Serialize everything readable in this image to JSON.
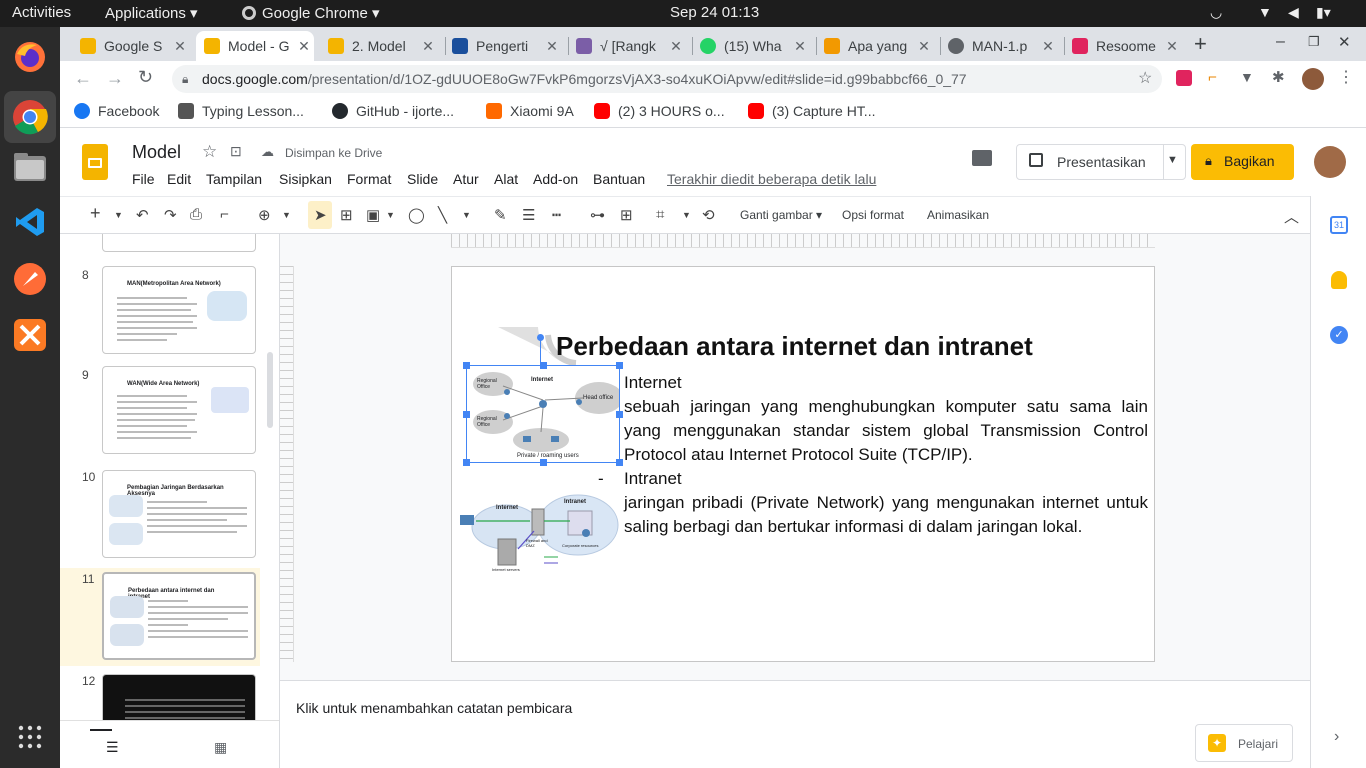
{
  "system": {
    "activities": "Activities",
    "applications": "Applications",
    "app_name": "Google Chrome",
    "datetime": "Sep 24  01:13"
  },
  "tabs": [
    {
      "title": "Google S",
      "color": "#f4b400"
    },
    {
      "title": "Model - G",
      "color": "#f4b400"
    },
    {
      "title": "2. Model",
      "color": "#f4b400"
    },
    {
      "title": "Pengerti",
      "color": "#1a4f9c"
    },
    {
      "title": "√ [Rangk",
      "color": "#7b5ea7"
    },
    {
      "title": "(15) Wha",
      "color": "#25d366"
    },
    {
      "title": "Apa yang",
      "color": "#f29900"
    },
    {
      "title": "MAN-1.p",
      "color": "#5f6368"
    },
    {
      "title": "Resoome",
      "color": "#e0245e"
    }
  ],
  "address": {
    "domain": "docs.google.com",
    "path": "/presentation/d/1OZ-gdUUOE8oGw7FvkP6mgorzsVjAX3-so4xuKOiApvw/edit#slide=id.g99babbcf66_0_77"
  },
  "bookmarks": [
    {
      "label": "Facebook",
      "color": "#1877f2"
    },
    {
      "label": "Typing Lesson...",
      "color": "#555555"
    },
    {
      "label": "GitHub - ijorte...",
      "color": "#24292e"
    },
    {
      "label": "Xiaomi 9A",
      "color": "#ff6900"
    },
    {
      "label": "(2) 3 HOURS o...",
      "color": "#ff0000"
    },
    {
      "label": "(3) Capture HT...",
      "color": "#ff0000"
    }
  ],
  "doc": {
    "title": "Model",
    "save_status": "Disimpan ke Drive",
    "last_edit": "Terakhir diedit beberapa detik lalu",
    "present_label": "Presentasikan",
    "share_label": "Bagikan"
  },
  "menus": [
    "File",
    "Edit",
    "Tampilan",
    "Sisipkan",
    "Format",
    "Slide",
    "Atur",
    "Alat",
    "Add-on",
    "Bantuan"
  ],
  "toolbar": {
    "replace_image": "Ganti gambar",
    "format_options": "Opsi format",
    "animate": "Animasikan"
  },
  "filmstrip": {
    "slides": [
      {
        "num": "8",
        "title": "MAN(Metropolitan Area Network)"
      },
      {
        "num": "9",
        "title": "WAN(Wide Area Network)"
      },
      {
        "num": "10",
        "title": "Pembagian Jaringan Berdasarkan Aksesnya"
      },
      {
        "num": "11",
        "title": "Perbedaan antara internet dan intranet"
      },
      {
        "num": "12",
        "title": ""
      }
    ]
  },
  "slide": {
    "title": "Perbedaan antara internet dan intranet",
    "bullet1_label": "Internet",
    "bullet1_text": "sebuah jaringan yang menghubungkan komputer satu sama lain yang menggunakan standar sistem global Transmission Control Protocol atau Internet Protocol Suite (TCP/IP).",
    "bullet2_label": "Intranet",
    "bullet2_text": "jaringan pribadi (Private Network) yang mengunakan internet untuk saling berbagi dan bertukar informasi di dalam jaringan lokal.",
    "diagram1": {
      "regional1": "Regional Office",
      "internet": "Internet",
      "regional2": "Regional Office",
      "head": "Head office",
      "roaming": "Private / roaming users"
    },
    "diagram2": {
      "internet": "Internet",
      "intranet": "Intranet",
      "firewall": "Firewall and DMZ",
      "internet_servers": "Internet servers",
      "corporate": "Corporate resources"
    }
  },
  "notes_placeholder": "Klik untuk menambahkan catatan pembicara",
  "explore_label": "Pelajari"
}
